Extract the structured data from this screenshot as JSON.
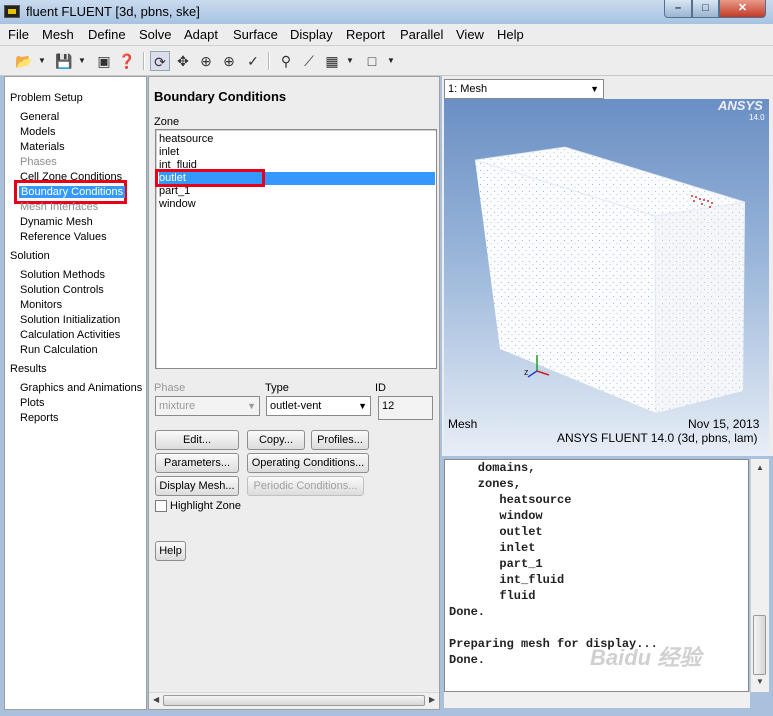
{
  "window": {
    "title": "fluent FLUENT  [3d, pbns, ske]",
    "min": "–",
    "max": "□",
    "close": "✕"
  },
  "menu": [
    "File",
    "Mesh",
    "Define",
    "Solve",
    "Adapt",
    "Surface",
    "Display",
    "Report",
    "Parallel",
    "View",
    "Help"
  ],
  "toolbar": {
    "icons": [
      "open-folder-icon",
      "save-icon",
      "camera-icon",
      "help-icon",
      "rotate-icon",
      "translate-icon",
      "zoom-in-icon",
      "zoom-fit-icon",
      "probe-icon",
      "magnify-icon",
      "axes-icon",
      "layout-icon",
      "window-icon"
    ]
  },
  "tree": {
    "problem_setup": "Problem Setup",
    "setup_items": [
      "General",
      "Models",
      "Materials",
      "Phases",
      "Cell Zone Conditions",
      "Boundary Conditions",
      "Mesh Interfaces",
      "Dynamic Mesh",
      "Reference Values"
    ],
    "solution": "Solution",
    "solution_items": [
      "Solution Methods",
      "Solution Controls",
      "Monitors",
      "Solution Initialization",
      "Calculation Activities",
      "Run Calculation"
    ],
    "results": "Results",
    "results_items": [
      "Graphics and Animations",
      "Plots",
      "Reports"
    ]
  },
  "task": {
    "title": "Boundary Conditions",
    "zone_label": "Zone",
    "zones": [
      "heatsource",
      "inlet",
      "int_fluid",
      "outlet",
      "part_1",
      "window"
    ],
    "selected_zone": "outlet",
    "phase_label": "Phase",
    "phase_value": "mixture",
    "type_label": "Type",
    "type_value": "outlet-vent",
    "id_label": "ID",
    "id_value": "12",
    "buttons": {
      "edit": "Edit...",
      "copy": "Copy...",
      "profiles": "Profiles...",
      "parameters": "Parameters...",
      "operating": "Operating Conditions...",
      "display_mesh": "Display Mesh...",
      "periodic": "Periodic Conditions...",
      "help": "Help"
    },
    "highlight_zone": "Highlight Zone"
  },
  "graphics": {
    "view": "1: Mesh",
    "logo": "ANSYS",
    "logo_version": "14.0",
    "caption_left": "Mesh",
    "date": "Nov 15, 2013",
    "version": "ANSYS FLUENT 14.0 (3d, pbns, lam)"
  },
  "console": {
    "lines": [
      "    domains,",
      "    zones,",
      "       heatsource",
      "       window",
      "       outlet",
      "       inlet",
      "       part_1",
      "       int_fluid",
      "       fluid",
      "Done.",
      "",
      "Preparing mesh for display...",
      "Done."
    ]
  },
  "watermark": "Baidu 经验"
}
